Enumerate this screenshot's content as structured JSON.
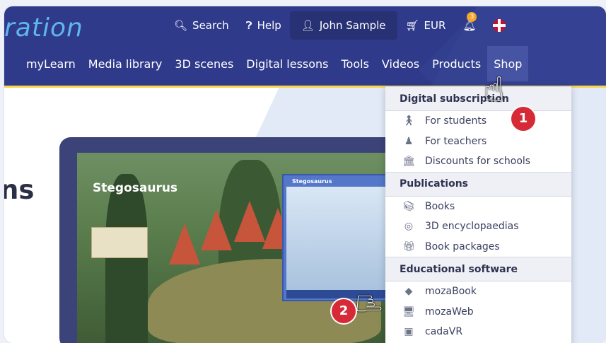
{
  "header": {
    "logo_text": "ration",
    "topbar": {
      "search_label": "Search",
      "help_label": "Help",
      "user_label": "John Sample",
      "currency_label": "EUR",
      "notification_count": "3"
    },
    "nav": [
      "myLearn",
      "Media library",
      "3D scenes",
      "Digital lessons",
      "Tools",
      "Videos",
      "Products",
      "Shop"
    ]
  },
  "main": {
    "heading_fragment": "ns",
    "device": {
      "title": "Stegosaurus",
      "panel_title": "Stegosaurus"
    }
  },
  "dropdown": {
    "sections": [
      {
        "title": "Digital subscription",
        "items": [
          {
            "label": "For students",
            "icon": "person-walking-icon"
          },
          {
            "label": "For teachers",
            "icon": "teacher-icon"
          },
          {
            "label": "Discounts for schools",
            "icon": "school-building-icon"
          }
        ]
      },
      {
        "title": "Publications",
        "items": [
          {
            "label": "Books",
            "icon": "books-icon"
          },
          {
            "label": "3D encyclopaedias",
            "icon": "3d-icon"
          },
          {
            "label": "Book packages",
            "icon": "gift-icon"
          }
        ]
      },
      {
        "title": "Educational software",
        "items": [
          {
            "label": "mozaBook",
            "icon": "diamond-icon"
          },
          {
            "label": "mozaWeb",
            "icon": "monitor-icon"
          },
          {
            "label": "cadaVR",
            "icon": "vr-headset-icon"
          }
        ]
      }
    ]
  },
  "annotations": {
    "marker_1": "1",
    "marker_2": "2"
  },
  "colors": {
    "header_bg": "#2f3a8a",
    "accent_yellow": "#f5d34a",
    "logo_blue": "#5fb6ee",
    "marker_red": "#d62a36"
  }
}
